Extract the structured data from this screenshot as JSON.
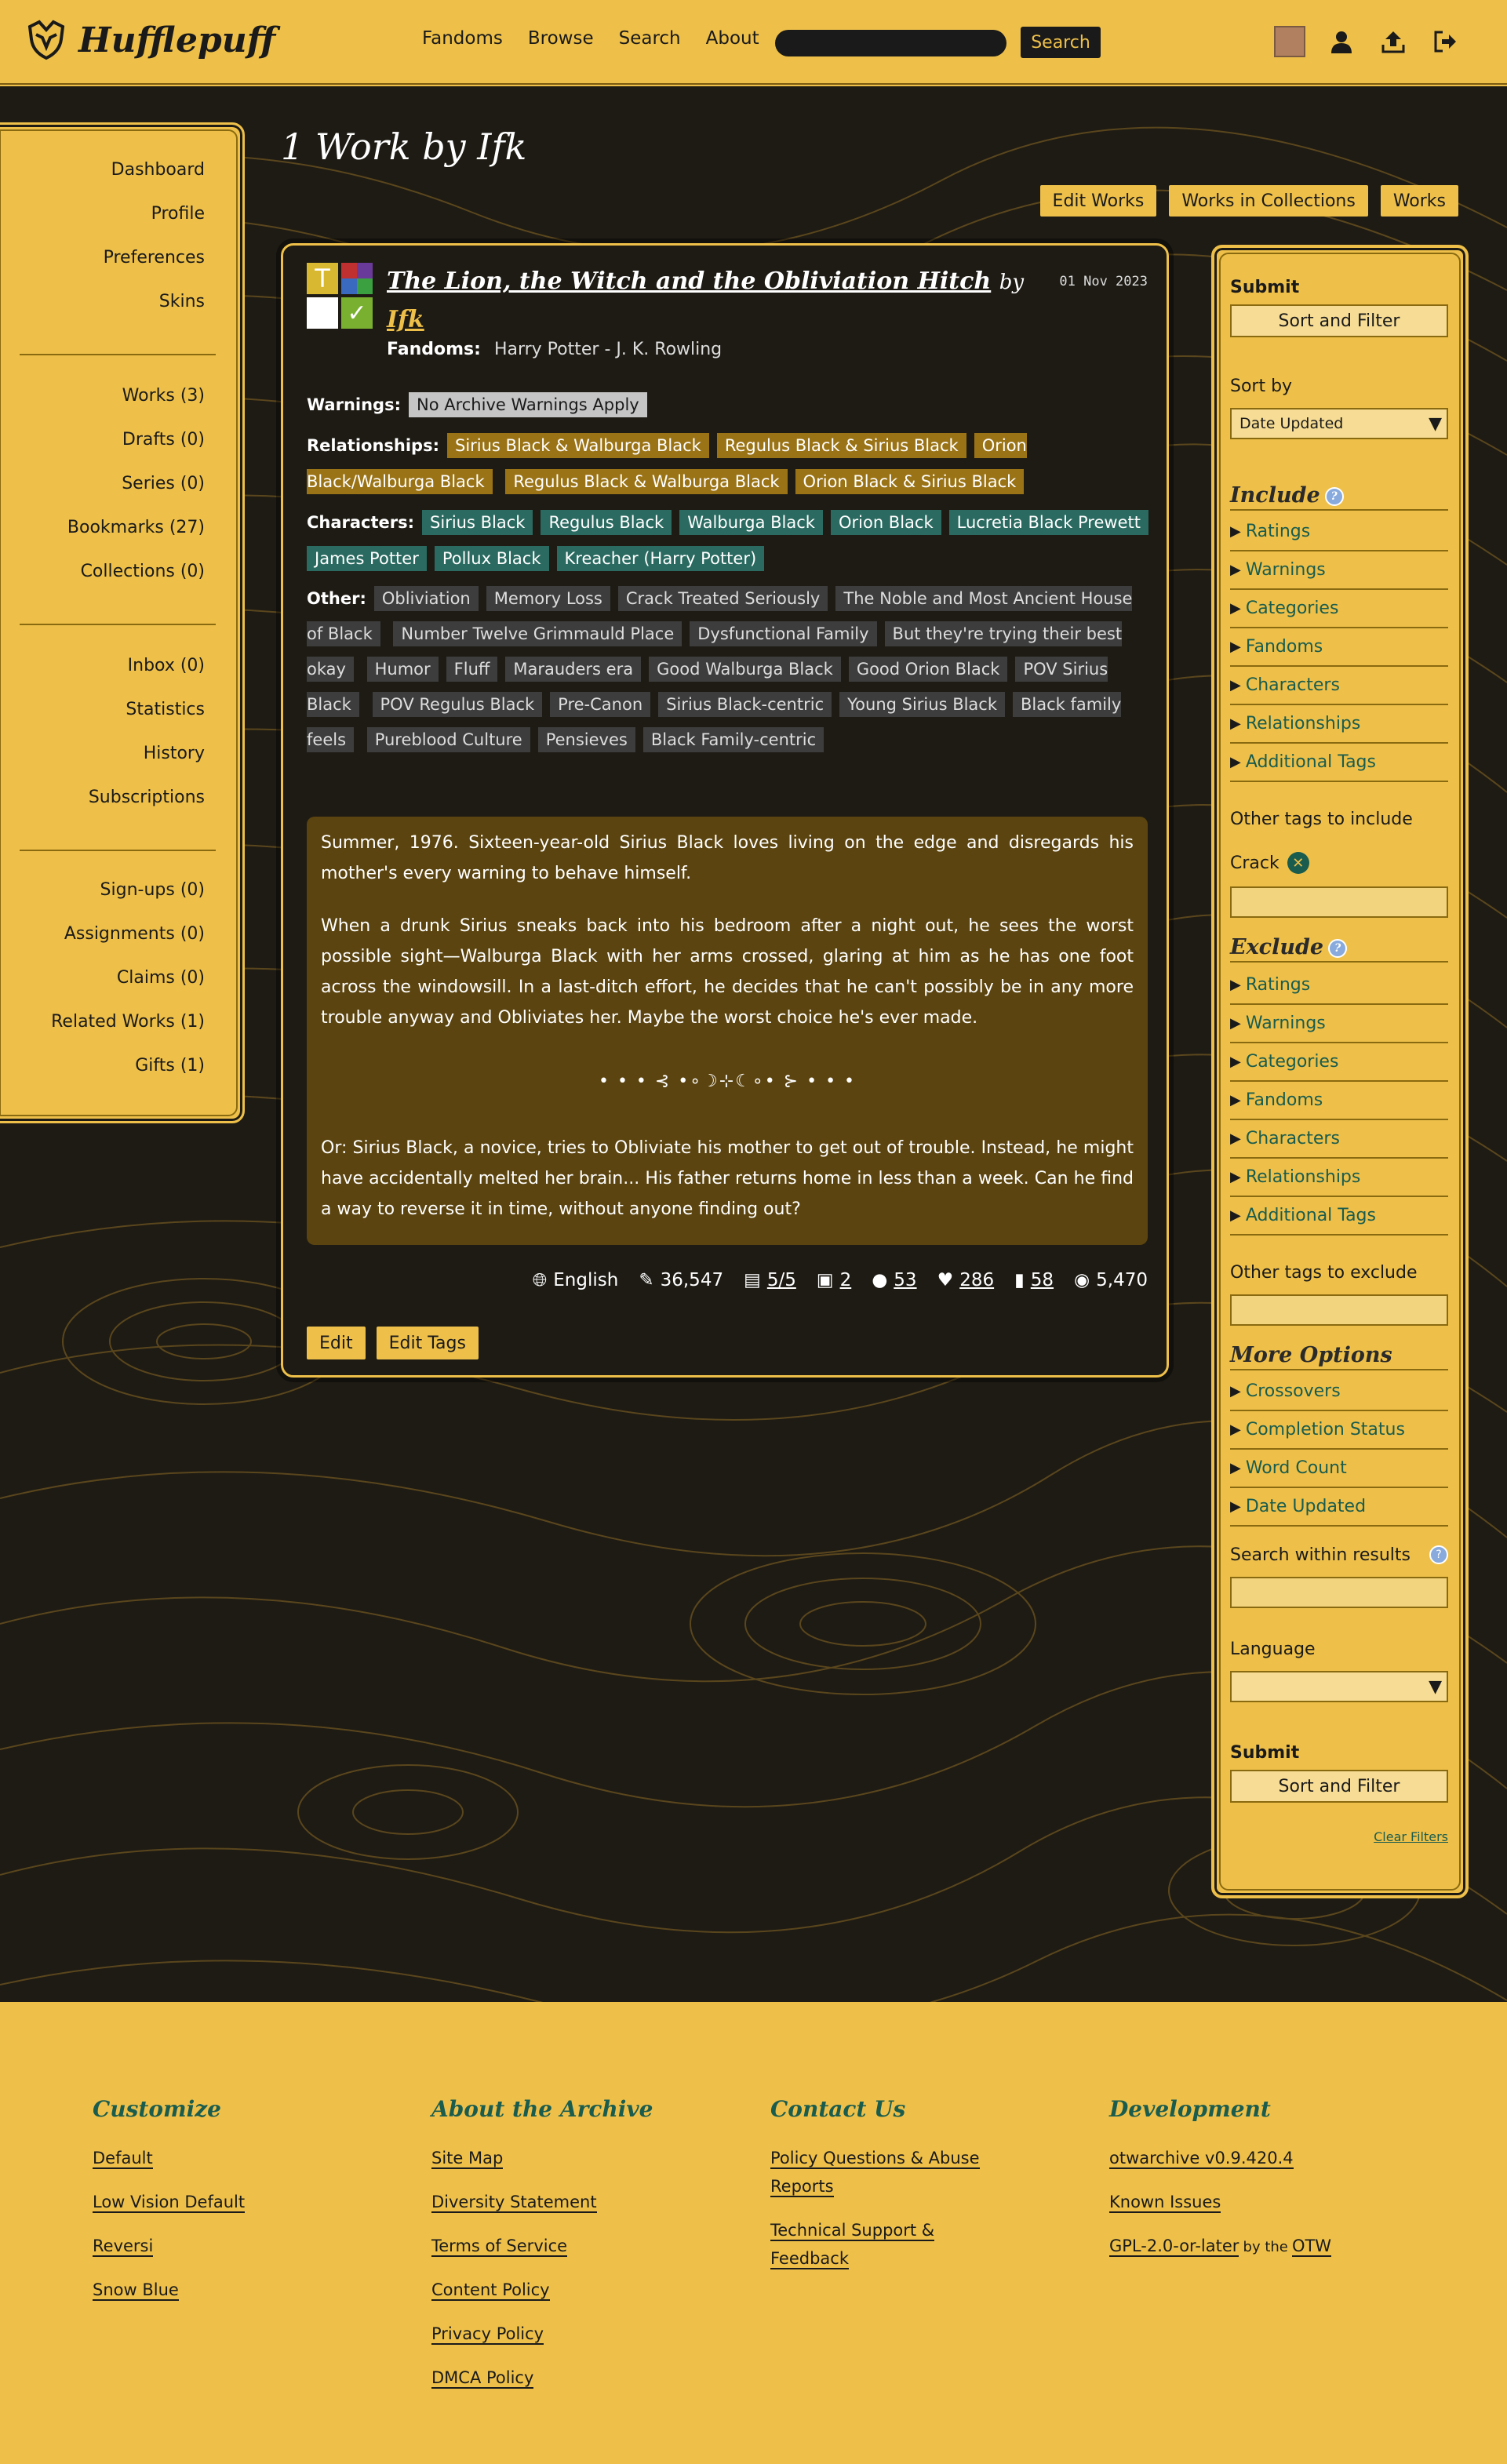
{
  "header": {
    "logo": "Hufflepuff",
    "nav": [
      "Fandoms",
      "Browse",
      "Search",
      "About"
    ],
    "search_button": "Search"
  },
  "left_sidebar": {
    "group1": [
      "Dashboard",
      "Profile",
      "Preferences",
      "Skins"
    ],
    "group2": [
      "Works (3)",
      "Drafts (0)",
      "Series (0)",
      "Bookmarks (27)",
      "Collections (0)"
    ],
    "group3": [
      "Inbox (0)",
      "Statistics",
      "History",
      "Subscriptions"
    ],
    "group4": [
      "Sign-ups (0)",
      "Assignments (0)",
      "Claims (0)",
      "Related Works (1)",
      "Gifts (1)"
    ]
  },
  "page_title": "1 Work by Ifk",
  "top_buttons": [
    "Edit Works",
    "Works in Collections",
    "Works"
  ],
  "work": {
    "title": "The Lion, the Witch and the Obliviation Hitch",
    "by": "by",
    "author": "Ifk",
    "date": "01 Nov 2023",
    "fandoms_label": "Fandoms:",
    "fandom": "Harry Potter - J. K. Rowling",
    "warnings_label": "Warnings:",
    "warnings": [
      "No Archive Warnings Apply"
    ],
    "relationships_label": "Relationships:",
    "relationships": [
      "Sirius Black & Walburga Black",
      "Regulus Black & Sirius Black",
      "Orion Black/Walburga Black",
      "Regulus Black & Walburga Black",
      "Orion Black & Sirius Black"
    ],
    "characters_label": "Characters:",
    "characters": [
      "Sirius Black",
      "Regulus Black",
      "Walburga Black",
      "Orion Black",
      "Lucretia Black Prewett",
      "James Potter",
      "Pollux Black",
      "Kreacher (Harry Potter)"
    ],
    "other_label": "Other:",
    "other": [
      "Obliviation",
      "Memory Loss",
      "Crack Treated Seriously",
      "The Noble and Most Ancient House of Black",
      "Number Twelve Grimmauld Place",
      "Dysfunctional Family",
      "But they're trying their best okay",
      "Humor",
      "Fluff",
      "Marauders era",
      "Good Walburga Black",
      "Good Orion Black",
      "POV Sirius Black",
      "POV Regulus Black",
      "Pre-Canon",
      "Sirius Black-centric",
      "Young Sirius Black",
      "Black family feels",
      "Pureblood Culture",
      "Pensieves",
      "Black Family-centric"
    ],
    "summary_p1": "Summer, 1976. Sixteen-year-old Sirius Black loves living on the edge and disregards his mother's every warning to behave himself.",
    "summary_p2": "When a drunk Sirius sneaks back into his bedroom after a night out, he sees the worst possible sight—Walburga Black with her arms crossed, glaring at him as he has one foot across the windowsill. In a last-ditch effort, he decides that he can't possibly be in any more trouble anyway and Obliviates her. Maybe the worst choice he's ever made.",
    "summary_ornament": "• • • ⊰ •∘☽⊹☾∘• ⊱ • • •",
    "summary_p3": "Or: Sirius Black, a novice, tries to Obliviate his mother to get out of trouble. Instead, he might have accidentally melted her brain... His father returns home in less than a week. Can he find a way to reverse it in time, without anyone finding out?",
    "stats": {
      "language": "English",
      "words": "36,547",
      "chapters": "5/5",
      "collections": "2",
      "comments": "53",
      "kudos": "286",
      "bookmarks": "58",
      "hits": "5,470"
    },
    "buttons": [
      "Edit",
      "Edit Tags"
    ]
  },
  "filters": {
    "submit_label": "Submit",
    "sort_filter": "Sort and Filter",
    "sort_by_label": "Sort by",
    "sort_by_value": "Date Updated",
    "include_title": "Include",
    "include_items": [
      "Ratings",
      "Warnings",
      "Categories",
      "Fandoms",
      "Characters",
      "Relationships",
      "Additional Tags"
    ],
    "other_include_label": "Other tags to include",
    "crack_tag": "Crack",
    "exclude_title": "Exclude",
    "exclude_items": [
      "Ratings",
      "Warnings",
      "Categories",
      "Fandoms",
      "Characters",
      "Relationships",
      "Additional Tags"
    ],
    "other_exclude_label": "Other tags to exclude",
    "more_title": "More Options",
    "more_items": [
      "Crossovers",
      "Completion Status",
      "Word Count",
      "Date Updated"
    ],
    "search_within_label": "Search within results",
    "language_label": "Language",
    "clear_filters": "Clear Filters"
  },
  "footer": {
    "customize": {
      "title": "Customize",
      "links": [
        "Default",
        "Low Vision Default",
        "Reversi",
        "Snow Blue"
      ]
    },
    "about": {
      "title": "About the Archive",
      "links": [
        "Site Map",
        "Diversity Statement",
        "Terms of Service",
        "Content Policy",
        "Privacy Policy",
        "DMCA Policy"
      ]
    },
    "contact": {
      "title": "Contact Us",
      "links": [
        "Policy Questions & Abuse Reports",
        "Technical Support & Feedback"
      ]
    },
    "dev": {
      "title": "Development",
      "links": [
        "otwarchive v0.9.420.4",
        "Known Issues",
        "GPL-2.0-or-later"
      ],
      "by_the": "by the",
      "otw": "OTW"
    }
  },
  "colors": {
    "accent": "#eec04a",
    "dark": "#1e1b14",
    "teal": "#2a6a60",
    "relationship": "#9a7316"
  }
}
